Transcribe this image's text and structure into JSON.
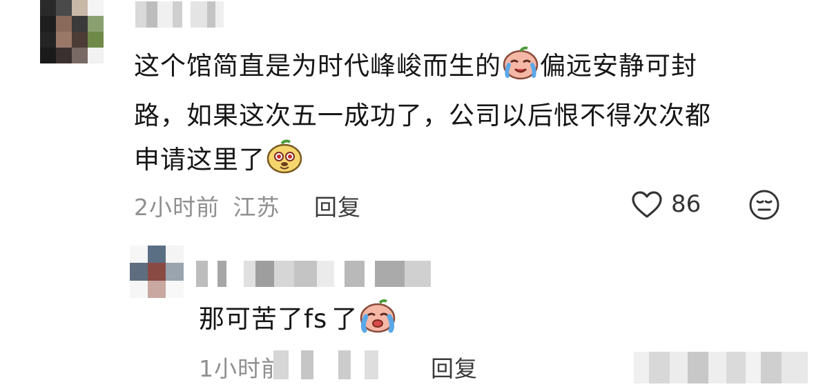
{
  "comment": {
    "text_line1": "这个馆简直是为时代峰峻而生的",
    "text_line1b": "偏远安静可封",
    "text_line2": "路，如果这次五一成功了，公司以后恨不得次次都",
    "text_line3": "申请这里了",
    "emoji1": "crying-face-emoji",
    "emoji2": "dog-face-emoji",
    "time": "2小时前",
    "location": "江苏",
    "reply_label": "回复",
    "like_count": "86",
    "like_icon": "heart-icon",
    "dislike_icon": "meh-face-icon"
  },
  "reply": {
    "text_a": "那可苦了fs",
    "text_b": "了",
    "emoji": "crying-face-emoji",
    "time": "1小时前",
    "reply_label": "回复"
  },
  "colors": {
    "text": "#161616",
    "meta": "#8f8f8f",
    "icon": "#333333"
  }
}
